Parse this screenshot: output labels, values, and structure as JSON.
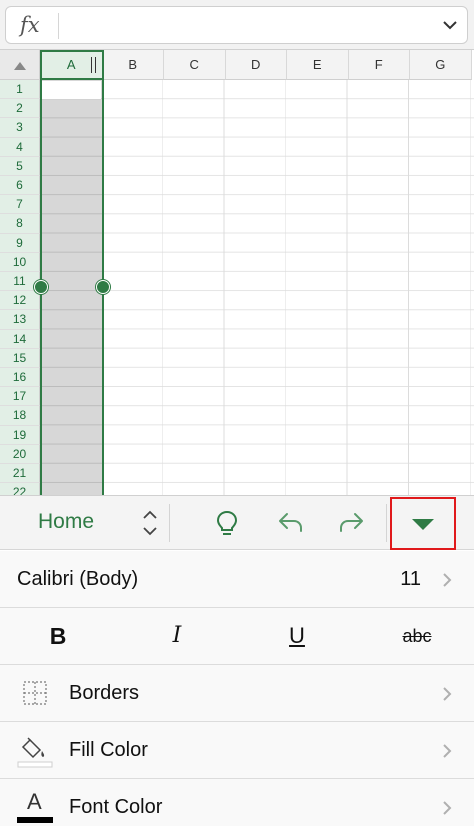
{
  "formula_bar": {
    "fx_label": "fx",
    "value": ""
  },
  "columns": [
    "A",
    "B",
    "C",
    "D",
    "E",
    "F",
    "G"
  ],
  "selected_column": "A",
  "rows": [
    "1",
    "2",
    "3",
    "4",
    "5",
    "6",
    "7",
    "8",
    "9",
    "10",
    "11",
    "12",
    "13",
    "14",
    "15",
    "16",
    "17",
    "18",
    "19",
    "20",
    "21",
    "22"
  ],
  "toolbar": {
    "tab_label": "Home"
  },
  "font": {
    "name": "Calibri (Body)",
    "size": "11"
  },
  "format_buttons": {
    "bold": "B",
    "italic": "I",
    "underline": "U",
    "strikethrough": "abc"
  },
  "ribbon_items": [
    {
      "label": "Borders",
      "icon": "borders-icon"
    },
    {
      "label": "Fill Color",
      "icon": "fill-color-icon"
    },
    {
      "label": "Font Color",
      "icon": "font-color-icon",
      "icon_letter": "A"
    }
  ],
  "colors": {
    "accent": "#2f7b45",
    "highlight_box": "#e0191b"
  }
}
